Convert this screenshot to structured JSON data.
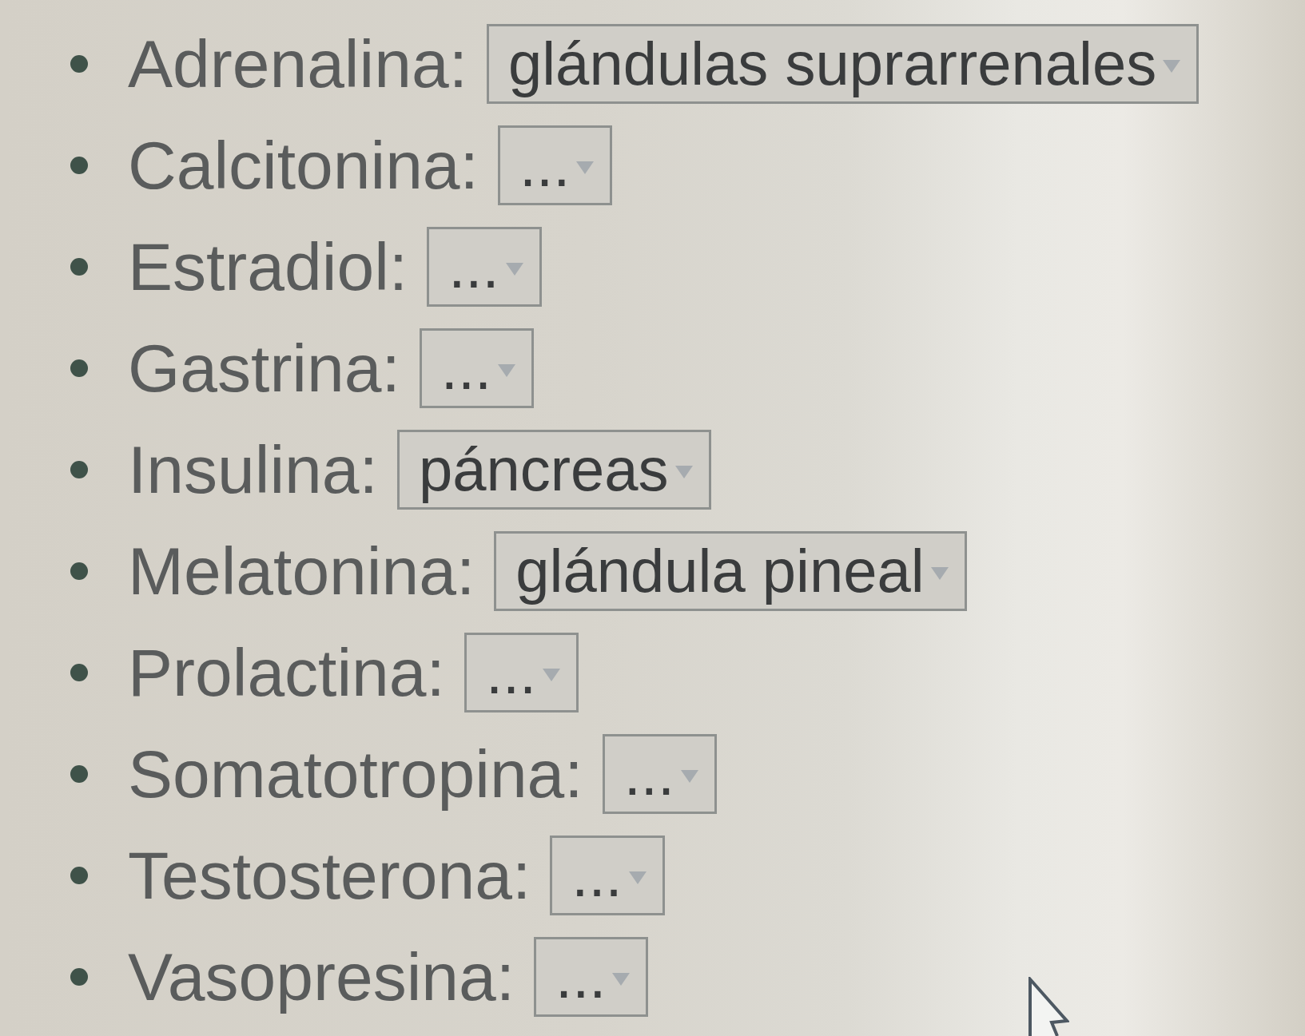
{
  "list": {
    "items": [
      {
        "label": "Adrenalina:",
        "dropdown": {
          "value": "glándulas suprarrenales"
        }
      },
      {
        "label": "Calcitonina:",
        "dropdown": {
          "value": "..."
        }
      },
      {
        "label": "Estradiol:",
        "dropdown": {
          "value": "..."
        }
      },
      {
        "label": "Gastrina:",
        "dropdown": {
          "value": "..."
        }
      },
      {
        "label": "Insulina:",
        "dropdown": {
          "value": "páncreas"
        }
      },
      {
        "label": "Melatonina:",
        "dropdown": {
          "value": "glándula pineal"
        }
      },
      {
        "label": "Prolactina:",
        "dropdown": {
          "value": "..."
        }
      },
      {
        "label": "Somatotropina:",
        "dropdown": {
          "value": "..."
        }
      },
      {
        "label": "Testosterona:",
        "dropdown": {
          "value": "..."
        }
      },
      {
        "label": "Vasopresina:",
        "dropdown": {
          "value": "..."
        }
      }
    ]
  }
}
